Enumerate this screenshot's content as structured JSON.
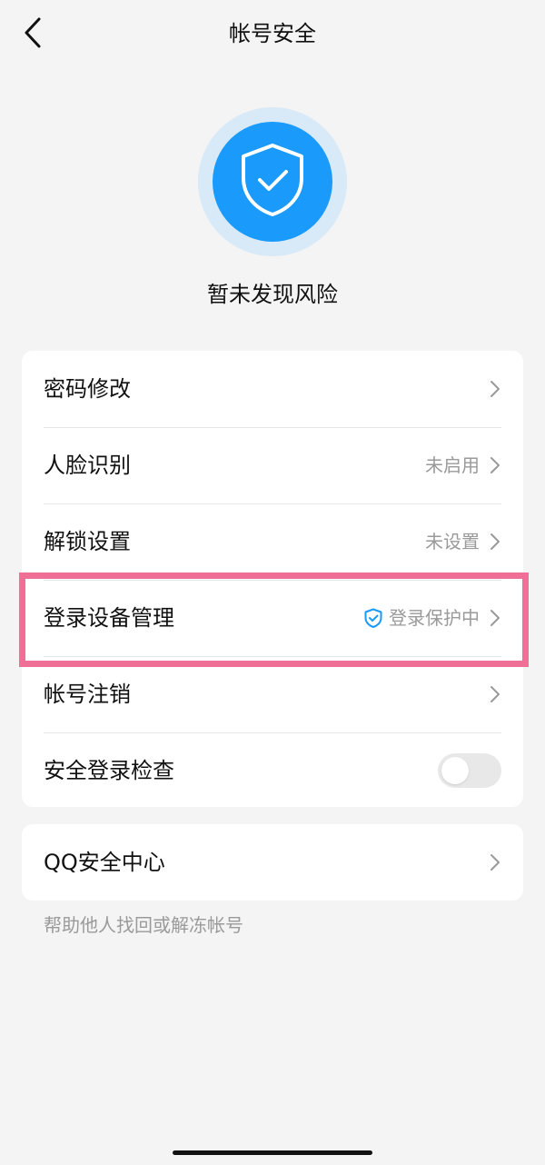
{
  "header": {
    "title": "帐号安全",
    "back_icon": "chevron-left-icon"
  },
  "hero": {
    "icon": "shield-check-icon",
    "status": "暂未发现风险",
    "colors": {
      "shield_fill": "#1a9bfb",
      "halo": "#d8e9f7"
    }
  },
  "security_list": {
    "items": [
      {
        "label": "密码修改",
        "value": ""
      },
      {
        "label": "人脸识别",
        "value": "未启用"
      },
      {
        "label": "解锁设置",
        "value": "未设置"
      },
      {
        "label": "登录设备管理",
        "value": "登录保护中",
        "value_icon": "shield-check-icon",
        "highlighted": true
      },
      {
        "label": "帐号注销",
        "value": ""
      }
    ],
    "toggle_row": {
      "label": "安全登录检查",
      "enabled": false
    }
  },
  "qq_center": {
    "label": "QQ安全中心"
  },
  "footer": {
    "help_link": "帮助他人找回或解冻帐号"
  },
  "colors": {
    "highlight_border": "#f06f96",
    "accent": "#1a9bfb",
    "background": "#f4f4f4"
  }
}
